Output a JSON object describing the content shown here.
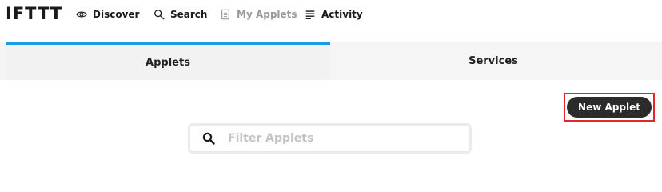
{
  "nav": {
    "logo": "IFTTT",
    "items": [
      {
        "label": "Discover",
        "icon": "eye-icon"
      },
      {
        "label": "Search",
        "icon": "search-icon"
      },
      {
        "label": "My Applets",
        "icon": "document-icon",
        "muted": true
      },
      {
        "label": "Activity",
        "icon": "list-icon"
      }
    ]
  },
  "tabs": [
    {
      "label": "Applets",
      "active": true
    },
    {
      "label": "Services",
      "active": false
    }
  ],
  "actions": {
    "new_applet_label": "New Applet"
  },
  "filter": {
    "placeholder": "Filter Applets",
    "value": ""
  },
  "colors": {
    "active_tab_accent": "#1a9be6",
    "highlight_box": "#e2262b",
    "button_bg": "#2b2b2b",
    "tab_bg": "#f5f5f5"
  }
}
